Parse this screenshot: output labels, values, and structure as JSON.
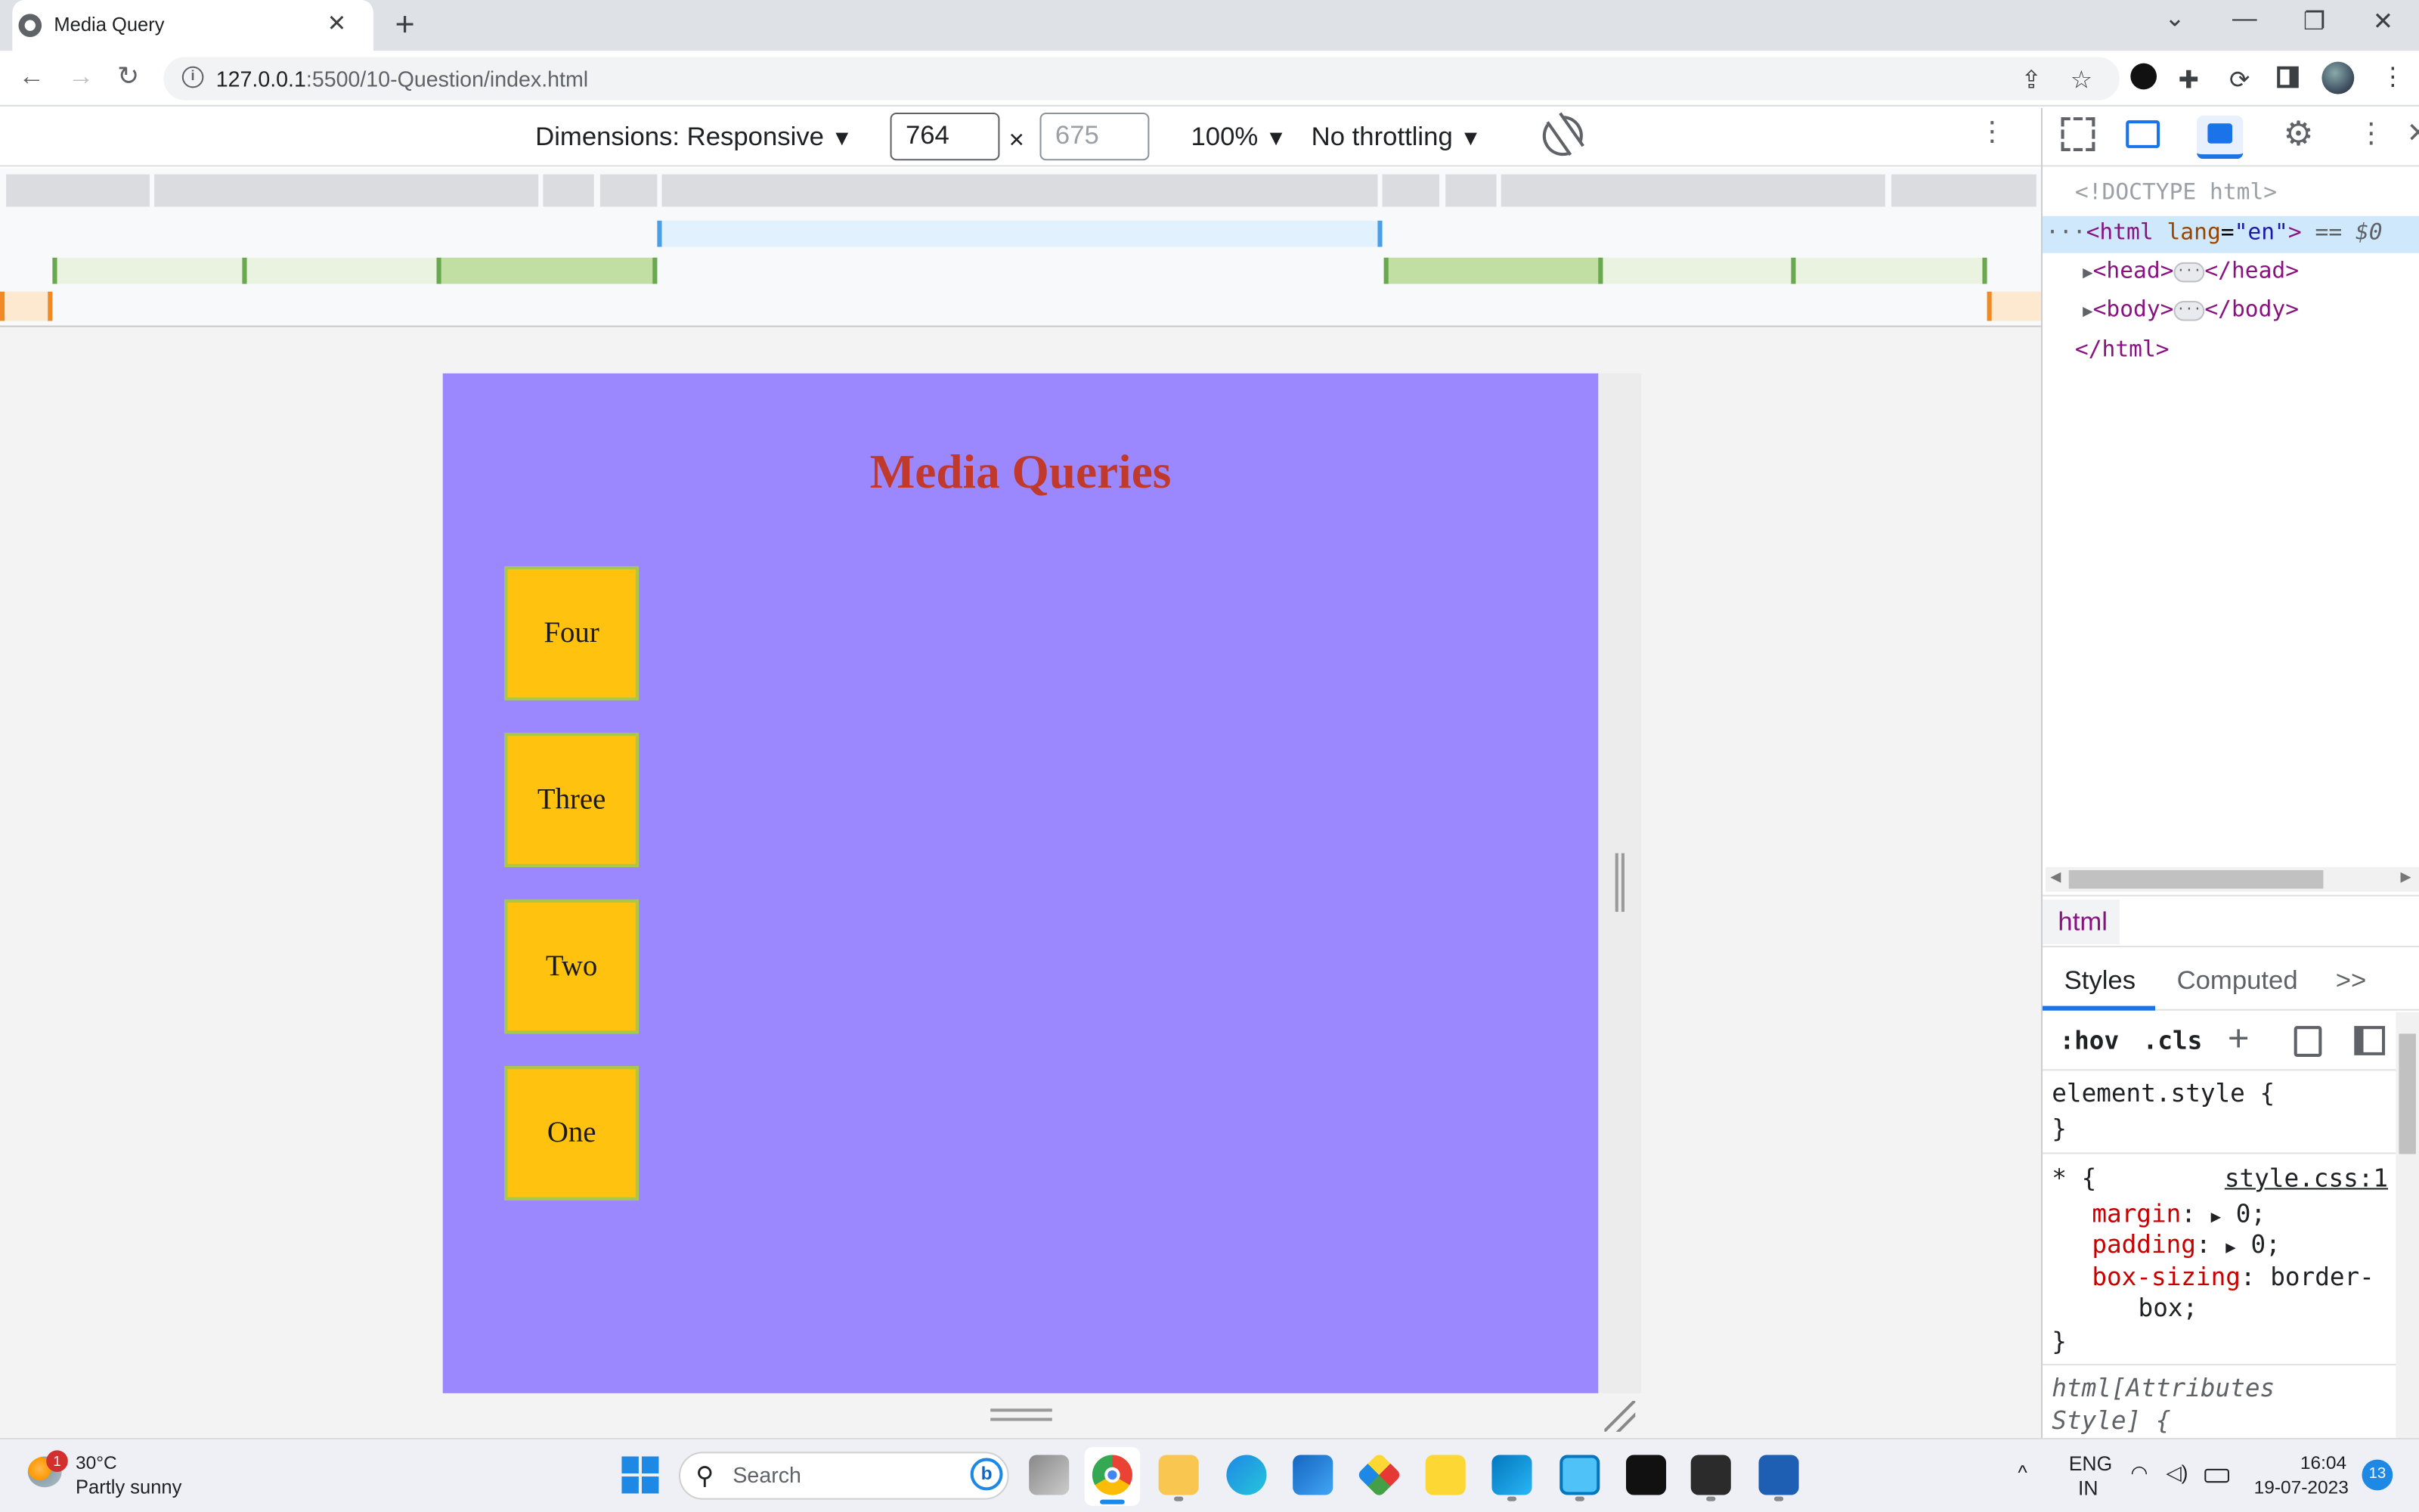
{
  "browser": {
    "tab_title": "Media Query",
    "tab_close": "✕",
    "new_tab": "+",
    "url_host": "127.0.0.1",
    "url_path": ":5500/10-Question/index.html",
    "window_controls": {
      "chevron": "⌄",
      "minimize": "—",
      "restore": "❐",
      "close": "✕"
    }
  },
  "device_toolbar": {
    "dimensions_label": "Dimensions: Responsive",
    "width": "764",
    "times": "×",
    "height": "675",
    "zoom": "100%",
    "throttling": "No throttling",
    "dropdown_arrow": "▼"
  },
  "page": {
    "title": "Media Queries",
    "boxes": [
      "Four",
      "Three",
      "Two",
      "One"
    ]
  },
  "devtools": {
    "doctype": "<!DOCTYPE html>",
    "html_open_tag": "<html",
    "html_lang_attr": "lang",
    "html_lang_val": "\"en\"",
    "html_open_close": ">",
    "html_selected_marker": "== $0",
    "head_open": "<head>",
    "head_close": "</head>",
    "body_open": "<body>",
    "body_close": "</body>",
    "html_close": "</html>",
    "ellipsis": "···",
    "crumb": "html",
    "tabs": {
      "styles": "Styles",
      "computed": "Computed",
      "more": ">>"
    },
    "filter": {
      "hov": ":hov",
      "cls": ".cls",
      "plus": "+"
    },
    "rules": {
      "element_style_open": "element.style {",
      "brace_close": "}",
      "star_open": "* {",
      "star_source": "style.css:1",
      "margin_prop": "margin",
      "margin_val": "0;",
      "padding_prop": "padding",
      "padding_val": "0;",
      "box_sizing_prop": "box-sizing",
      "box_sizing_val": "border-",
      "box_sizing_val2": "box;",
      "attr_rule": "html[Attributes",
      "attr_rule2": "Style] {"
    }
  },
  "taskbar": {
    "weather_temp": "30°C",
    "weather_desc": "Partly sunny",
    "weather_badge": "1",
    "search_placeholder": "Search",
    "lang_top": "ENG",
    "lang_bottom": "IN",
    "time": "16:04",
    "date": "19-07-2023",
    "notification_count": "13"
  },
  "colors": {
    "page_background": "#9b88ff",
    "title_color": "#c0392b",
    "box_fill": "#ffc20e",
    "box_border": "#a7c84f",
    "accent": "#1a73e8"
  }
}
